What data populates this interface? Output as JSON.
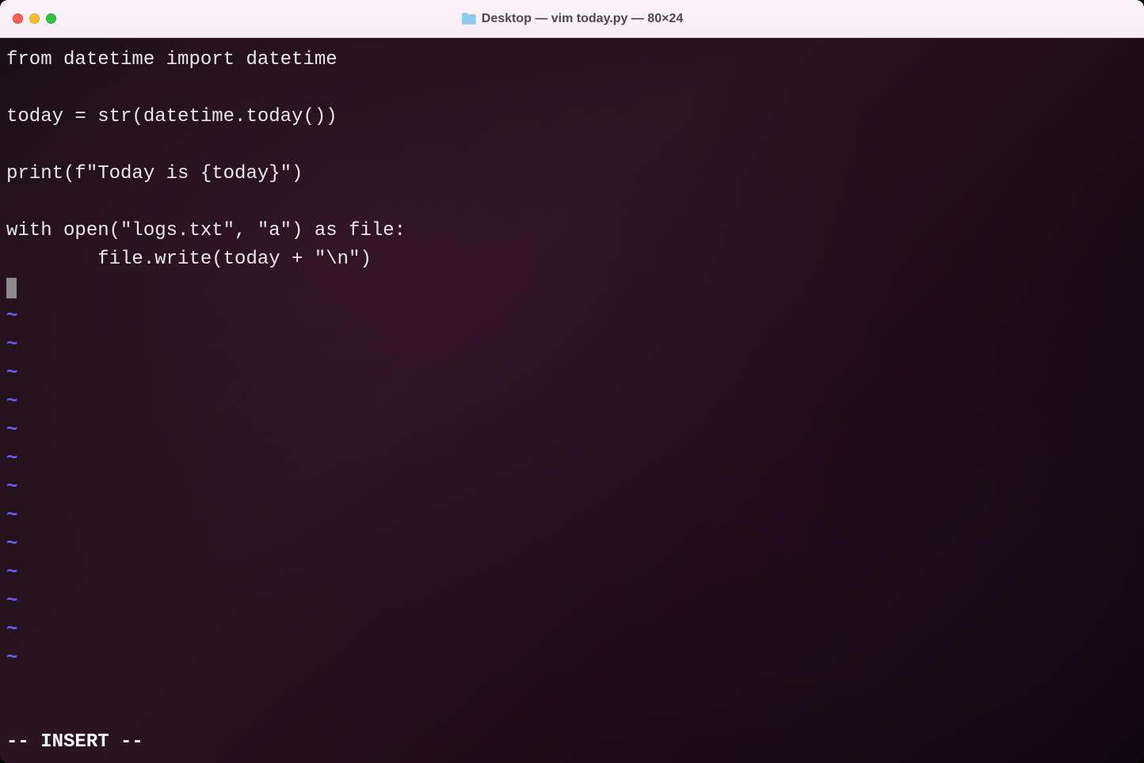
{
  "titlebar": {
    "title": "Desktop — vim today.py — 80×24"
  },
  "code": {
    "lines": [
      "from datetime import datetime",
      "",
      "today = str(datetime.today())",
      "",
      "print(f\"Today is {today}\")",
      "",
      "with open(\"logs.txt\", \"a\") as file:",
      "        file.write(today + \"\\n\")"
    ]
  },
  "vim": {
    "tilde": "~",
    "tilde_count": 13,
    "mode": "-- INSERT --"
  }
}
